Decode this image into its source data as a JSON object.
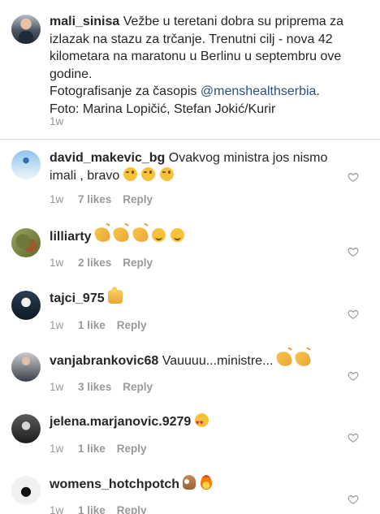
{
  "caption": {
    "username": "mali_sinisa",
    "text_before_mention": "Vežbe u teretani dobra su priprema za izlazak na stazu za trčanje. Trenutni cilj - nova 42 kilometara na maratonu u Berlinu u septembru ove godine.",
    "text_line_b": "Fotografisanje za časopis ",
    "mention": "@menshealthserbia",
    "mention_suffix": ".",
    "credit": "Foto: Marina Lopičić, Stefan Jokić/Kurir",
    "time": "1w",
    "avatar_icon": "profile-photo"
  },
  "comments": [
    {
      "username": "david_makevic_bg",
      "text": "Ovakvog ministra jos nismo imali , bravo",
      "emojis": [
        "wink",
        "wink",
        "wink"
      ],
      "time": "1w",
      "likes": "7 likes",
      "reply": "Reply"
    },
    {
      "username": "lilliarty",
      "text": "",
      "emojis": [
        "clap",
        "clap",
        "clap",
        "smile",
        "smile"
      ],
      "time": "1w",
      "likes": "2 likes",
      "reply": "Reply"
    },
    {
      "username": "tajci_975",
      "text": "",
      "emojis": [
        "thumbs"
      ],
      "time": "1w",
      "likes": "1 like",
      "reply": "Reply"
    },
    {
      "username": "vanjabrankovic68",
      "text": "Vauuuu...ministre...",
      "emojis": [
        "clap",
        "clap"
      ],
      "time": "1w",
      "likes": "3 likes",
      "reply": "Reply"
    },
    {
      "username": "jelena.marjanovic.9279",
      "text": "",
      "emojis": [
        "hearteyes"
      ],
      "time": "1w",
      "likes": "1 like",
      "reply": "Reply"
    },
    {
      "username": "womens_hotchpotch",
      "text": "",
      "emojis": [
        "okhand",
        "fire"
      ],
      "time": "1w",
      "likes": "1 like",
      "reply": "Reply"
    }
  ],
  "colors": {
    "text": "#262626",
    "muted": "#999999",
    "mention": "#2a4f82",
    "divider": "#dbdbdb"
  },
  "icons": {
    "like": "heart-outline-icon"
  }
}
